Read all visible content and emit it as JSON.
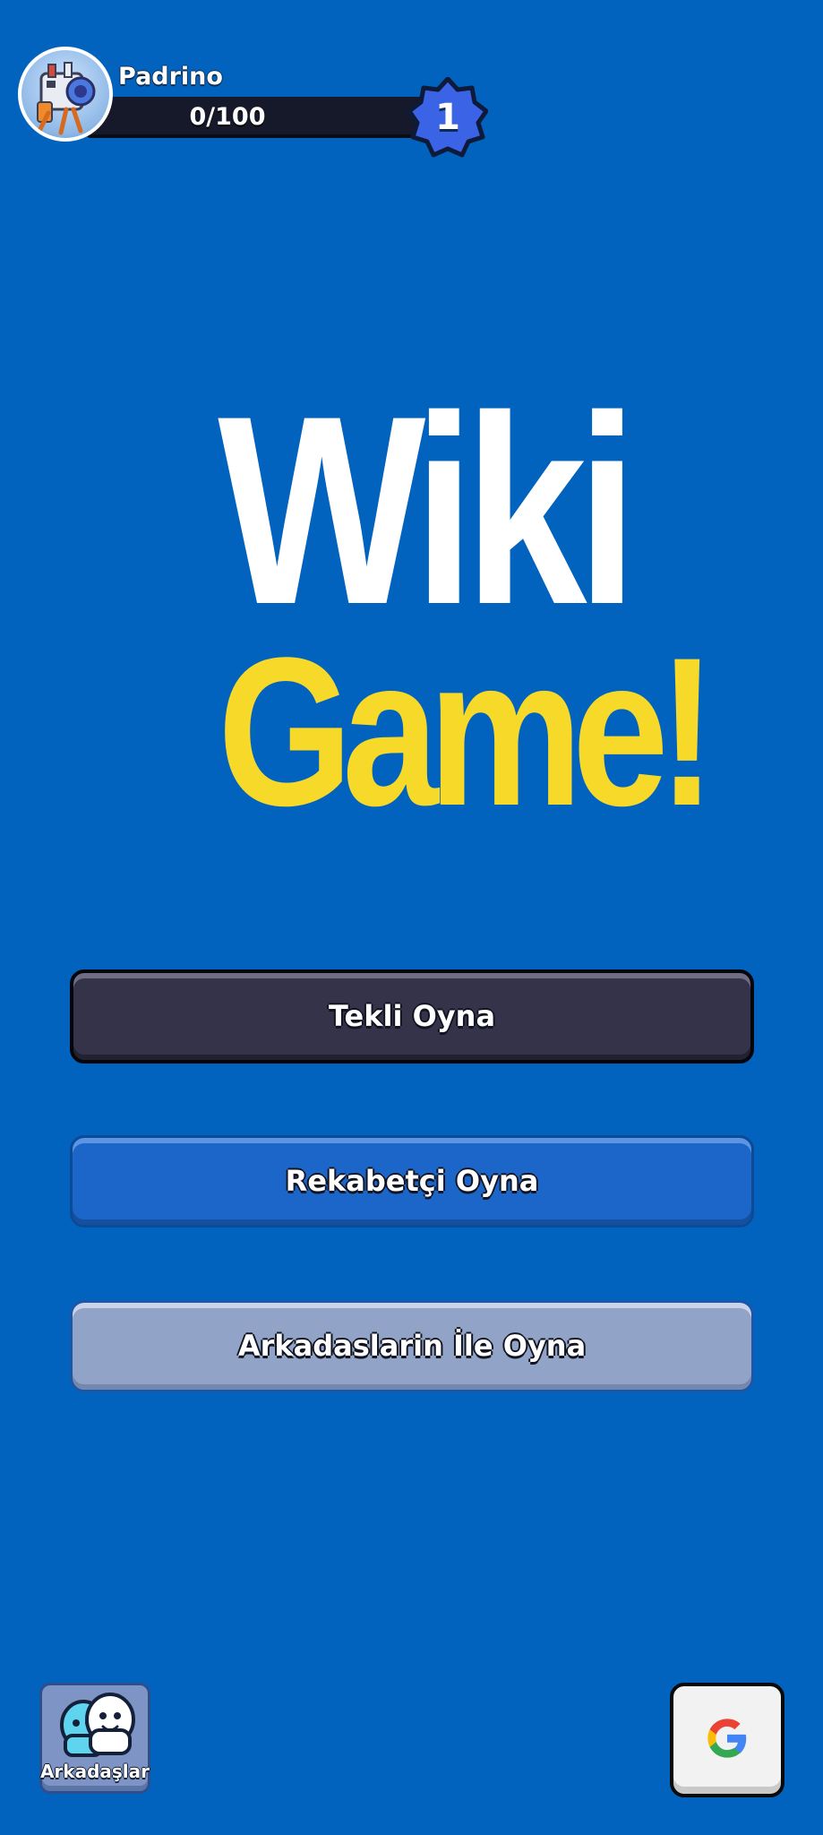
{
  "profile": {
    "name": "Padrino",
    "xp_text": "0/100",
    "xp_fraction": 0.0,
    "level": "1"
  },
  "logo": {
    "line1": "Wiki",
    "line2": "Game!"
  },
  "modes": {
    "solo": "Tekli Oyna",
    "ranked": "Rekabetçi Oyna",
    "friends": "Arkadaslarin İle Oyna"
  },
  "bottom": {
    "friends_label": "Arkadaşlar",
    "friends_icon": "friends-icon",
    "google_icon": "google-icon"
  },
  "colors": {
    "background": "#0263bf",
    "logo_yellow": "#f7d92a",
    "level_badge": "#3b63e6"
  }
}
